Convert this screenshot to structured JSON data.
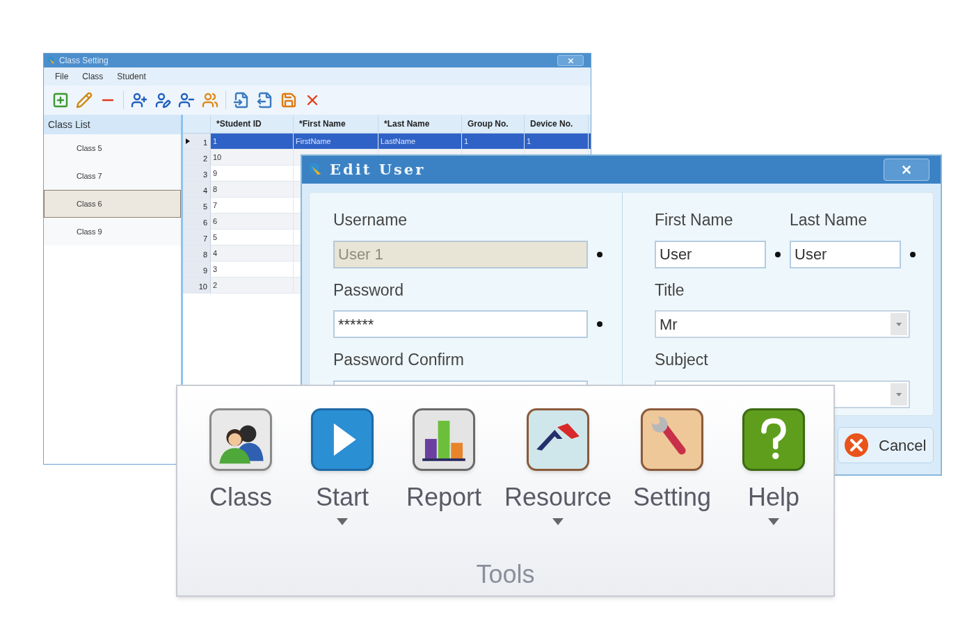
{
  "class_setting": {
    "title": "Class Setting",
    "menu": [
      "File",
      "Class",
      "Student"
    ],
    "class_list": {
      "title": "Class List",
      "items": [
        {
          "label": "Class 5",
          "selected": false
        },
        {
          "label": "Class 7",
          "selected": false
        },
        {
          "label": "Class 6",
          "selected": true
        },
        {
          "label": "Class 9",
          "selected": false
        }
      ]
    },
    "grid": {
      "columns": [
        "*Student ID",
        "*First Name",
        "*Last Name",
        "Group No.",
        "Device No."
      ],
      "rows": [
        {
          "number": "1",
          "selected": true,
          "cells": [
            "1",
            "FirstName",
            "LastName",
            "1",
            "1"
          ]
        },
        {
          "number": "2",
          "selected": false,
          "cells": [
            "10"
          ]
        },
        {
          "number": "3",
          "selected": false,
          "cells": [
            "9"
          ]
        },
        {
          "number": "4",
          "selected": false,
          "cells": [
            "8"
          ]
        },
        {
          "number": "5",
          "selected": false,
          "cells": [
            "7"
          ]
        },
        {
          "number": "6",
          "selected": false,
          "cells": [
            "6"
          ]
        },
        {
          "number": "7",
          "selected": false,
          "cells": [
            "5"
          ]
        },
        {
          "number": "8",
          "selected": false,
          "cells": [
            "4"
          ]
        },
        {
          "number": "9",
          "selected": false,
          "cells": [
            "3"
          ]
        },
        {
          "number": "10",
          "selected": false,
          "cells": [
            "2"
          ]
        }
      ]
    }
  },
  "edit_user": {
    "title": "Edit User",
    "left_fields": [
      {
        "label": "Username",
        "value": "User 1",
        "disabled": true,
        "required": true
      },
      {
        "label": "Password",
        "value": "******",
        "disabled": false,
        "required": true
      },
      {
        "label": "Password Confirm",
        "disabled": false
      }
    ],
    "name_fields": [
      {
        "label": "First Name",
        "value": "User",
        "required": true
      },
      {
        "label": "Last Name",
        "value": "User",
        "required": true
      }
    ],
    "dropdowns": [
      {
        "label": "Title",
        "value": "Mr"
      },
      {
        "label": "Subject"
      }
    ],
    "cancel_button": "Cancel"
  },
  "ribbon": {
    "group": "Tools",
    "buttons": [
      {
        "label": "Class",
        "has_menu": false
      },
      {
        "label": "Start",
        "has_menu": true
      },
      {
        "label": "Report",
        "has_menu": false
      },
      {
        "label": "Resource",
        "has_menu": true
      },
      {
        "label": "Setting",
        "has_menu": false
      },
      {
        "label": "Help",
        "has_menu": true
      }
    ]
  }
}
